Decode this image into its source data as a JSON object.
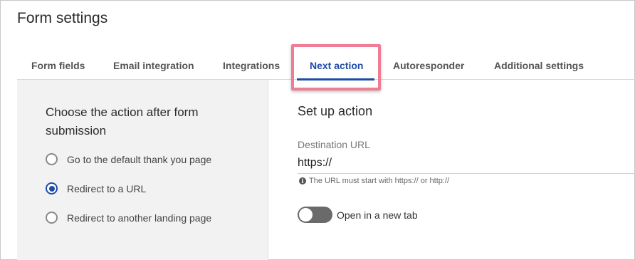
{
  "header": {
    "title": "Form settings"
  },
  "tabs": [
    {
      "label": "Form fields",
      "active": false
    },
    {
      "label": "Email integration",
      "active": false
    },
    {
      "label": "Integrations",
      "active": false
    },
    {
      "label": "Next action",
      "active": true
    },
    {
      "label": "Autoresponder",
      "active": false
    },
    {
      "label": "Additional settings",
      "active": false
    }
  ],
  "left": {
    "heading": "Choose the action after form submission",
    "options": [
      {
        "label": "Go to the default thank you page",
        "selected": false
      },
      {
        "label": "Redirect to a URL",
        "selected": true
      },
      {
        "label": "Redirect to another landing page",
        "selected": false
      }
    ]
  },
  "right": {
    "heading": "Set up action",
    "destination_label": "Destination URL",
    "destination_value": "https://",
    "hint": "The URL must start with https:// or http://",
    "toggle_label": "Open in a new tab",
    "toggle_on": false
  },
  "colors": {
    "accent": "#1f4ba5",
    "highlight": "#ee7d93"
  }
}
